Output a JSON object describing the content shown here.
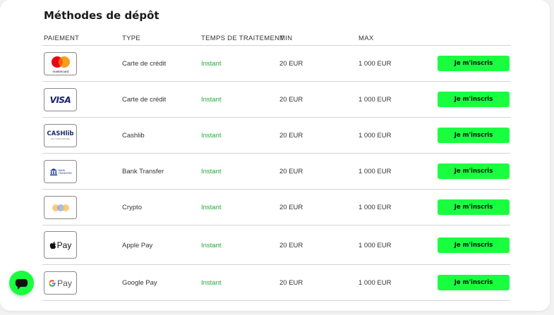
{
  "title": "Méthodes de dépôt",
  "headers": {
    "payment": "PAIEMENT",
    "type": "TYPE",
    "processing": "TEMPS DE TRAITEMENT",
    "min": "MIN",
    "max": "MAX"
  },
  "rows": [
    {
      "logo": "mastercard-logo",
      "logo_text": "mastercard",
      "type": "Carte de crédit",
      "time": "Instant",
      "min": "20 EUR",
      "max": "1 000 EUR",
      "button": "Je m'inscris"
    },
    {
      "logo": "visa-logo",
      "logo_text": "VISA",
      "type": "Carte de crédit",
      "time": "Instant",
      "min": "20 EUR",
      "max": "1 000 EUR",
      "button": "Je m'inscris"
    },
    {
      "logo": "cashlib-logo",
      "logo_text": "CASHlib",
      "logo_sub": "PAY CASH ONLINE",
      "type": "Cashlib",
      "time": "Instant",
      "min": "20 EUR",
      "max": "1 000 EUR",
      "button": "Je m'inscris"
    },
    {
      "logo": "bank-transfer-logo",
      "logo_text": "BANK TRANSFER",
      "type": "Bank Transfer",
      "time": "Instant",
      "min": "20 EUR",
      "max": "1 000 EUR",
      "button": "Je m'inscris"
    },
    {
      "logo": "crypto-logo",
      "type": "Crypto",
      "time": "Instant",
      "min": "20 EUR",
      "max": "1 000 EUR",
      "button": "Je m'inscris"
    },
    {
      "logo": "apple-pay-logo",
      "logo_text": "Pay",
      "type": "Apple Pay",
      "time": "Instant",
      "min": "20 EUR",
      "max": "1 000 EUR",
      "button": "Je m'inscris"
    },
    {
      "logo": "google-pay-logo",
      "logo_text": "Pay",
      "type": "Google Pay",
      "time": "Instant",
      "min": "20 EUR",
      "max": "1 000 EUR",
      "button": "Je m'inscris"
    }
  ],
  "colors": {
    "accent": "#19ff3f",
    "instant": "#1faa38",
    "divider": "#d4d4d4"
  },
  "chat_icon": "chat-icon"
}
